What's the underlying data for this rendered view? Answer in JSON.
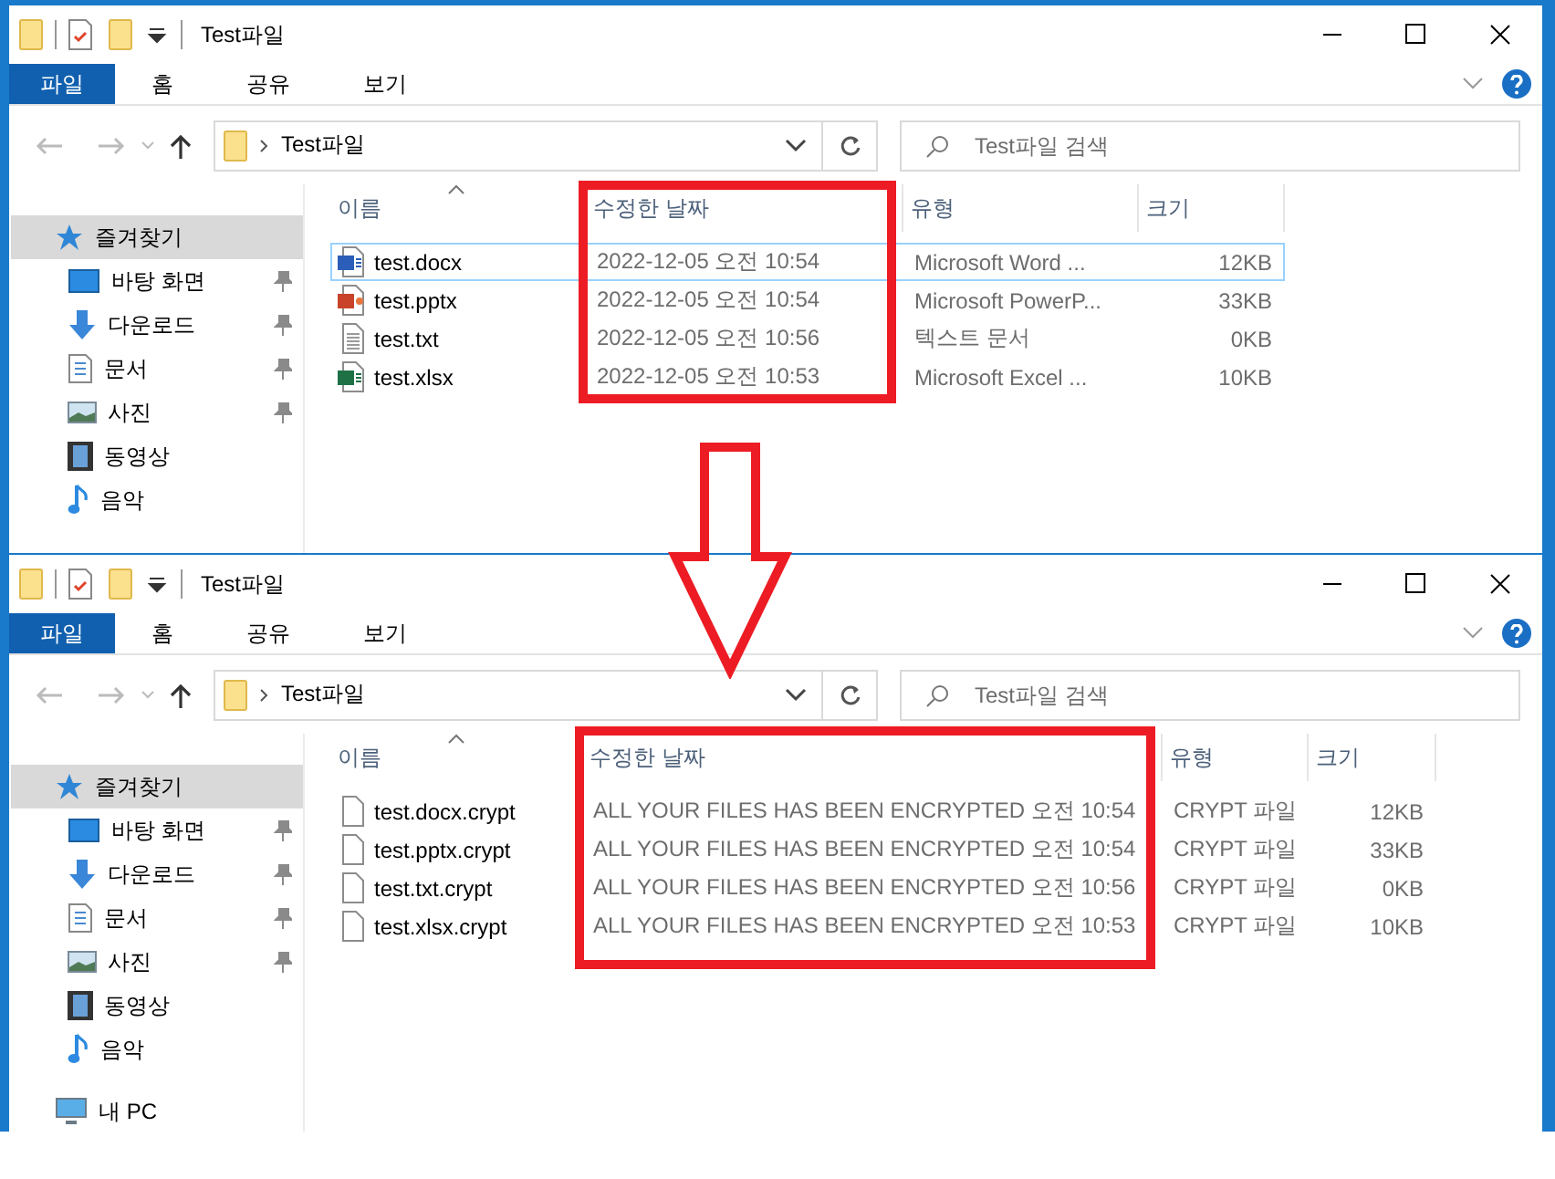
{
  "windows": [
    {
      "title": "Test파일",
      "ribbon_tabs": [
        {
          "label": "파일",
          "selected": true
        },
        {
          "label": "홈",
          "selected": false
        },
        {
          "label": "공유",
          "selected": false
        },
        {
          "label": "보기",
          "selected": false
        }
      ],
      "address": "Test파일",
      "search": {
        "placeholder": "Test파일 검색"
      },
      "sidebar": [
        {
          "label": "즐겨찾기",
          "kind": "star",
          "selected": true,
          "children": [
            {
              "label": "바탕 화면",
              "kind": "desktop",
              "pinned": true
            },
            {
              "label": "다운로드",
              "kind": "download",
              "pinned": true
            },
            {
              "label": "문서",
              "kind": "documents",
              "pinned": true
            },
            {
              "label": "사진",
              "kind": "pictures",
              "pinned": true
            },
            {
              "label": "동영상",
              "kind": "videos",
              "pinned": false
            },
            {
              "label": "음악",
              "kind": "music",
              "pinned": false
            }
          ]
        }
      ],
      "columns": [
        {
          "label": "이름",
          "sorted": true,
          "highlighted": false
        },
        {
          "label": "수정한 날짜",
          "sorted": false,
          "highlighted": true
        },
        {
          "label": "유형",
          "sorted": false,
          "highlighted": false
        },
        {
          "label": "크기",
          "sorted": false,
          "highlighted": false
        }
      ],
      "rows": [
        {
          "kind": "word",
          "name": "test.docx",
          "date": "2022-12-05 오전 10:54",
          "type": "Microsoft Word ...",
          "size": "12KB",
          "focused": true
        },
        {
          "kind": "powerpoint",
          "name": "test.pptx",
          "date": "2022-12-05 오전 10:54",
          "type": "Microsoft PowerP...",
          "size": "33KB",
          "focused": false
        },
        {
          "kind": "text",
          "name": "test.txt",
          "date": "2022-12-05 오전 10:56",
          "type": "텍스트 문서",
          "size": "0KB",
          "focused": false
        },
        {
          "kind": "excel",
          "name": "test.xlsx",
          "date": "2022-12-05 오전 10:53",
          "type": "Microsoft Excel ...",
          "size": "10KB",
          "focused": false
        }
      ]
    },
    {
      "title": "Test파일",
      "ribbon_tabs": [
        {
          "label": "파일",
          "selected": true
        },
        {
          "label": "홈",
          "selected": false
        },
        {
          "label": "공유",
          "selected": false
        },
        {
          "label": "보기",
          "selected": false
        }
      ],
      "address": "Test파일",
      "search": {
        "placeholder": "Test파일 검색"
      },
      "sidebar": [
        {
          "label": "즐겨찾기",
          "kind": "star",
          "selected": true,
          "children": [
            {
              "label": "바탕 화면",
              "kind": "desktop",
              "pinned": true
            },
            {
              "label": "다운로드",
              "kind": "download",
              "pinned": true
            },
            {
              "label": "문서",
              "kind": "documents",
              "pinned": true
            },
            {
              "label": "사진",
              "kind": "pictures",
              "pinned": true
            },
            {
              "label": "동영상",
              "kind": "videos",
              "pinned": false
            },
            {
              "label": "음악",
              "kind": "music",
              "pinned": false
            }
          ]
        },
        {
          "label": "내 PC",
          "kind": "pc",
          "selected": false
        }
      ],
      "columns": [
        {
          "label": "이름",
          "sorted": true,
          "highlighted": false
        },
        {
          "label": "수정한 날짜",
          "sorted": false,
          "highlighted": true
        },
        {
          "label": "유형",
          "sorted": false,
          "highlighted": false
        },
        {
          "label": "크기",
          "sorted": false,
          "highlighted": false
        }
      ],
      "rows": [
        {
          "kind": "blank",
          "name": "test.docx.crypt",
          "date": "ALL YOUR FILES HAS BEEN ENCRYPTED 오전 10:54",
          "type": "CRYPT 파일",
          "size": "12KB",
          "focused": false
        },
        {
          "kind": "blank",
          "name": "test.pptx.crypt",
          "date": "ALL YOUR FILES HAS BEEN ENCRYPTED 오전 10:54",
          "type": "CRYPT 파일",
          "size": "33KB",
          "focused": false
        },
        {
          "kind": "blank",
          "name": "test.txt.crypt",
          "date": "ALL YOUR FILES HAS BEEN ENCRYPTED 오전 10:56",
          "type": "CRYPT 파일",
          "size": "0KB",
          "focused": false
        },
        {
          "kind": "blank",
          "name": "test.xlsx.crypt",
          "date": "ALL YOUR FILES HAS BEEN ENCRYPTED 오전 10:53",
          "type": "CRYPT 파일",
          "size": "10KB",
          "focused": false
        }
      ]
    }
  ],
  "arrow": {
    "shown": true
  }
}
